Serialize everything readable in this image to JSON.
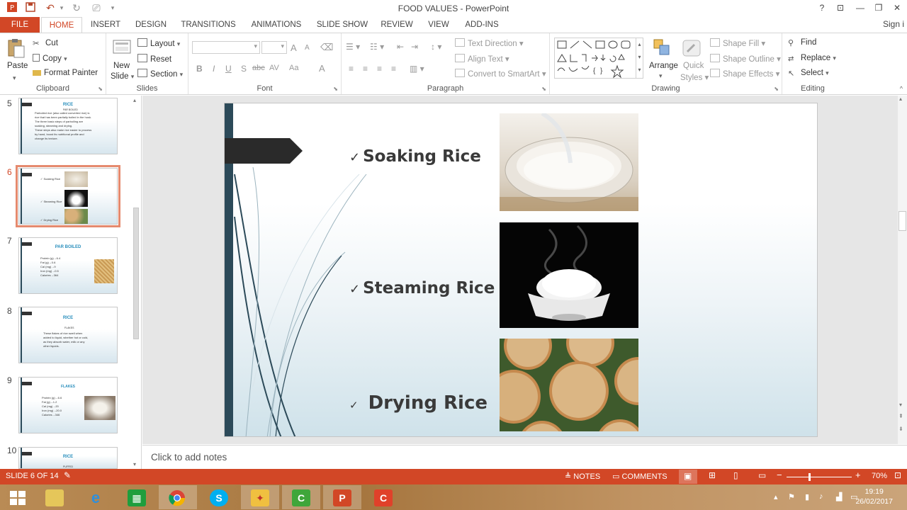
{
  "window": {
    "title": "FOOD VALUES - PowerPoint",
    "help": "?",
    "sign_in": "Sign i"
  },
  "tabs": [
    "FILE",
    "HOME",
    "INSERT",
    "DESIGN",
    "TRANSITIONS",
    "ANIMATIONS",
    "SLIDE SHOW",
    "REVIEW",
    "VIEW",
    "ADD-INS"
  ],
  "active_tab": "HOME",
  "ribbon": {
    "clipboard": {
      "label": "Clipboard",
      "paste": "Paste",
      "cut": "Cut",
      "copy": "Copy",
      "format_painter": "Format Painter"
    },
    "slides": {
      "label": "Slides",
      "new_slide_1": "New",
      "new_slide_2": "Slide",
      "layout": "Layout",
      "reset": "Reset",
      "section": "Section"
    },
    "font": {
      "label": "Font",
      "bold": "B",
      "italic": "I",
      "underline": "U",
      "shadow": "S",
      "strike": "abc",
      "spacing": "AV",
      "case": "Aa",
      "color": "A",
      "grow": "A",
      "shrink": "A"
    },
    "paragraph": {
      "label": "Paragraph",
      "text_direction": "Text Direction",
      "align_text": "Align Text",
      "convert": "Convert to SmartArt"
    },
    "drawing": {
      "label": "Drawing",
      "arrange": "Arrange",
      "quick_styles_1": "Quick",
      "quick_styles_2": "Styles",
      "shape_fill": "Shape Fill",
      "shape_outline": "Shape Outline",
      "shape_effects": "Shape Effects"
    },
    "editing": {
      "label": "Editing",
      "find": "Find",
      "replace": "Replace",
      "select": "Select"
    }
  },
  "thumbnails": [
    {
      "num": "5",
      "title": "RICE",
      "sub": "PAR BOILED",
      "lines": [
        "Parboiled rice (also called converted rice) is",
        "rice that has been partially boiled in the husk.",
        "The three basic steps of parboiling are",
        "soaking, steaming and drying.",
        "These steps also make rice easier to process",
        "by hand, boost its nutritional profile and",
        "change its texture."
      ]
    },
    {
      "num": "6",
      "title": "",
      "lines": [
        "Soaking Rice",
        "Steaming Rice",
        "Drying Rice"
      ]
    },
    {
      "num": "7",
      "title": "PAR BOILED",
      "lines": [
        "Protein (g)→6.4",
        "Fat (g)→0.6",
        "Cal (mg)→9",
        "Iron (mg)→0.5",
        "Calories→364"
      ]
    },
    {
      "num": "8",
      "title": "RICE",
      "sub": "FLAKES",
      "lines": [
        "These flakes of rice swell when",
        "added to liquid, whether hot or cold,",
        "as they absorb water, milk or any",
        "other liquids."
      ]
    },
    {
      "num": "9",
      "title": "FLAKES",
      "lines": [
        "Protein (g)→6.6",
        "Fat (g)→1.2",
        "Cal (mg)→20",
        "Iron (mg)→20.0",
        "Calories→346"
      ]
    },
    {
      "num": "10",
      "title": "RICE",
      "sub": "PUFFED",
      "lines": []
    }
  ],
  "slide": {
    "items": [
      {
        "check": "✓",
        "label": "Soaking Rice"
      },
      {
        "check": "✓",
        "label": "Steaming Rice"
      },
      {
        "check": "✓",
        "label": "Drying Rice"
      }
    ]
  },
  "notes_placeholder": "Click to add notes",
  "status": {
    "slide_of": "SLIDE 6 OF 14",
    "notes": "NOTES",
    "comments": "COMMENTS",
    "zoom": "70%"
  },
  "taskbar": {
    "time": "19:19",
    "date": "26/02/2017"
  },
  "colors": {
    "accent": "#d24726",
    "slide_bar": "#2c4a59",
    "thumb_title": "#2a8fbd"
  }
}
